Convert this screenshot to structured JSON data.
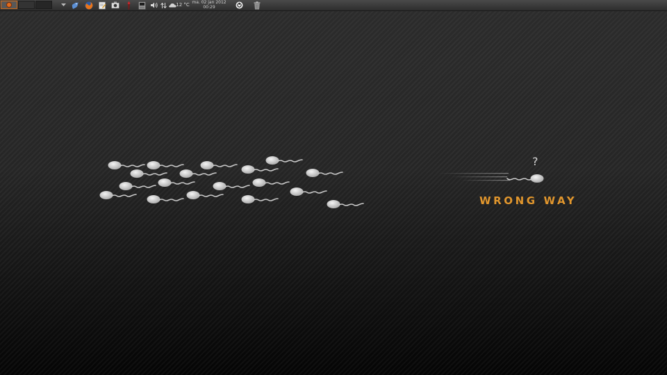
{
  "panel": {
    "workspaces": [
      "ws-1",
      "ws-2",
      "ws-3"
    ],
    "active_workspace": 1,
    "tray": {
      "temperature": "12 °C",
      "clock_date": "ma. 02 jan 2012",
      "clock_time": "00:29"
    },
    "launchers": [
      "menu-arrow-icon",
      "pidgin-bird-icon",
      "firefox-icon",
      "text-editor-icon",
      "screenshot-icon",
      "torch-icon",
      "terminal-icon"
    ],
    "tray_icons": [
      "volume-icon",
      "network-arrows-icon",
      "weather-cloud-icon"
    ],
    "right_icons": [
      "power-icon",
      "trash-icon"
    ]
  },
  "wallpaper": {
    "caption": "WRONG WAY",
    "question": "?",
    "accent_color": "#e1962d",
    "sperm_color": "#d4d4d4"
  }
}
